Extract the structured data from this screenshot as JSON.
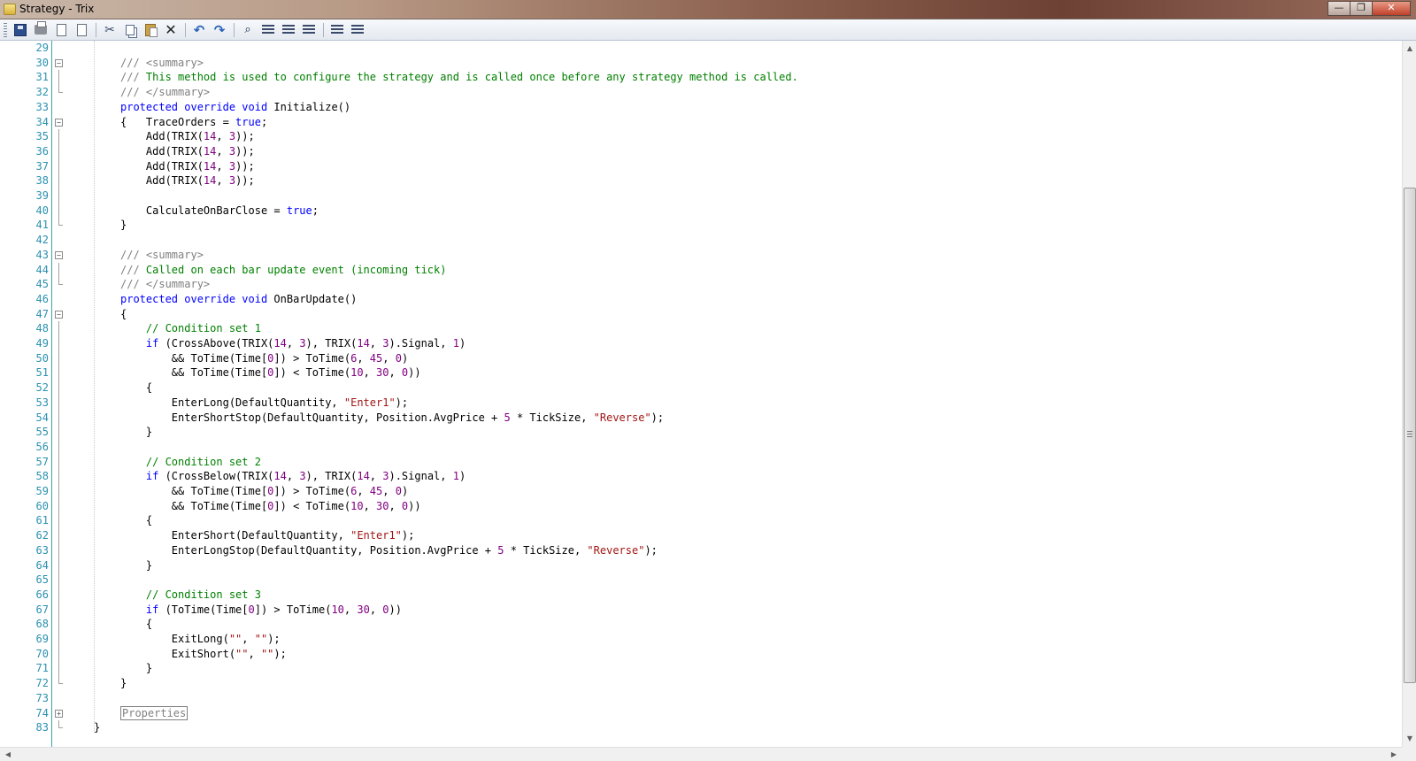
{
  "window": {
    "title": "Strategy - Trix",
    "min_label": "—",
    "max_label": "❐",
    "close_label": "✕"
  },
  "icons": {
    "save": "save-icon",
    "print": "print-icon",
    "preview": "print-preview-icon",
    "export": "export-icon",
    "cut": "cut-icon",
    "copy": "copy-icon",
    "paste": "paste-icon",
    "delete": "delete-icon",
    "undo": "undo-icon",
    "redo": "redo-icon",
    "find": "find-icon",
    "replace": "replace-icon",
    "indent": "indent-icon",
    "outdent": "outdent-icon",
    "comment": "comment-icon",
    "uncomment": "uncomment-icon"
  },
  "editor": {
    "lines": [
      {
        "num": "29",
        "fold": "",
        "tokens": []
      },
      {
        "num": "30",
        "fold": "minus",
        "tokens": [
          [
            "xd",
            "/// "
          ],
          [
            "xd",
            "<summary>"
          ]
        ]
      },
      {
        "num": "31",
        "fold": "bar",
        "tokens": [
          [
            "xd",
            "/// "
          ],
          [
            "cm",
            "This method is used to configure the strategy and is called once before any strategy method is called."
          ]
        ]
      },
      {
        "num": "32",
        "fold": "end",
        "tokens": [
          [
            "xd",
            "/// "
          ],
          [
            "xd",
            "</summary>"
          ]
        ]
      },
      {
        "num": "33",
        "fold": "",
        "tokens": [
          [
            "kw",
            "protected"
          ],
          [
            "",
            " "
          ],
          [
            "kw",
            "override"
          ],
          [
            "",
            " "
          ],
          [
            "kw",
            "void"
          ],
          [
            "",
            " Initialize()"
          ]
        ]
      },
      {
        "num": "34",
        "fold": "minus",
        "tokens": [
          [
            "",
            "{   TraceOrders = "
          ],
          [
            "kw",
            "true"
          ],
          [
            "",
            ";"
          ]
        ]
      },
      {
        "num": "35",
        "fold": "bar",
        "tokens": [
          [
            "",
            "    Add(TRIX("
          ],
          [
            "num",
            "14"
          ],
          [
            "",
            ", "
          ],
          [
            "num",
            "3"
          ],
          [
            "",
            "));"
          ]
        ]
      },
      {
        "num": "36",
        "fold": "bar",
        "tokens": [
          [
            "",
            "    Add(TRIX("
          ],
          [
            "num",
            "14"
          ],
          [
            "",
            ", "
          ],
          [
            "num",
            "3"
          ],
          [
            "",
            "));"
          ]
        ]
      },
      {
        "num": "37",
        "fold": "bar",
        "tokens": [
          [
            "",
            "    Add(TRIX("
          ],
          [
            "num",
            "14"
          ],
          [
            "",
            ", "
          ],
          [
            "num",
            "3"
          ],
          [
            "",
            "));"
          ]
        ]
      },
      {
        "num": "38",
        "fold": "bar",
        "tokens": [
          [
            "",
            "    Add(TRIX("
          ],
          [
            "num",
            "14"
          ],
          [
            "",
            ", "
          ],
          [
            "num",
            "3"
          ],
          [
            "",
            "));"
          ]
        ]
      },
      {
        "num": "39",
        "fold": "bar",
        "tokens": []
      },
      {
        "num": "40",
        "fold": "bar",
        "tokens": [
          [
            "",
            "    CalculateOnBarClose = "
          ],
          [
            "kw",
            "true"
          ],
          [
            "",
            ";"
          ]
        ]
      },
      {
        "num": "41",
        "fold": "end",
        "tokens": [
          [
            "",
            "}"
          ]
        ]
      },
      {
        "num": "42",
        "fold": "",
        "tokens": []
      },
      {
        "num": "43",
        "fold": "minus",
        "tokens": [
          [
            "xd",
            "/// "
          ],
          [
            "xd",
            "<summary>"
          ]
        ]
      },
      {
        "num": "44",
        "fold": "bar",
        "tokens": [
          [
            "xd",
            "/// "
          ],
          [
            "cm",
            "Called on each bar update event (incoming tick)"
          ]
        ]
      },
      {
        "num": "45",
        "fold": "end",
        "tokens": [
          [
            "xd",
            "/// "
          ],
          [
            "xd",
            "</summary>"
          ]
        ]
      },
      {
        "num": "46",
        "fold": "",
        "tokens": [
          [
            "kw",
            "protected"
          ],
          [
            "",
            " "
          ],
          [
            "kw",
            "override"
          ],
          [
            "",
            " "
          ],
          [
            "kw",
            "void"
          ],
          [
            "",
            " OnBarUpdate()"
          ]
        ]
      },
      {
        "num": "47",
        "fold": "minus",
        "tokens": [
          [
            "",
            "{"
          ]
        ]
      },
      {
        "num": "48",
        "fold": "bar",
        "tokens": [
          [
            "",
            "    "
          ],
          [
            "cm",
            "// Condition set 1"
          ]
        ]
      },
      {
        "num": "49",
        "fold": "bar",
        "tokens": [
          [
            "",
            "    "
          ],
          [
            "kw",
            "if"
          ],
          [
            "",
            " (CrossAbove(TRIX("
          ],
          [
            "num",
            "14"
          ],
          [
            "",
            ", "
          ],
          [
            "num",
            "3"
          ],
          [
            "",
            "), TRIX("
          ],
          [
            "num",
            "14"
          ],
          [
            "",
            ", "
          ],
          [
            "num",
            "3"
          ],
          [
            "",
            ").Signal, "
          ],
          [
            "num",
            "1"
          ],
          [
            "",
            ")"
          ]
        ]
      },
      {
        "num": "50",
        "fold": "bar",
        "tokens": [
          [
            "",
            "        && ToTime(Time["
          ],
          [
            "num",
            "0"
          ],
          [
            "",
            "]) > ToTime("
          ],
          [
            "num",
            "6"
          ],
          [
            "",
            ", "
          ],
          [
            "num",
            "45"
          ],
          [
            "",
            ", "
          ],
          [
            "num",
            "0"
          ],
          [
            "",
            ")"
          ]
        ]
      },
      {
        "num": "51",
        "fold": "bar",
        "tokens": [
          [
            "",
            "        && ToTime(Time["
          ],
          [
            "num",
            "0"
          ],
          [
            "",
            "]) < ToTime("
          ],
          [
            "num",
            "10"
          ],
          [
            "",
            ", "
          ],
          [
            "num",
            "30"
          ],
          [
            "",
            ", "
          ],
          [
            "num",
            "0"
          ],
          [
            "",
            "))"
          ]
        ]
      },
      {
        "num": "52",
        "fold": "bar",
        "tokens": [
          [
            "",
            "    {"
          ]
        ]
      },
      {
        "num": "53",
        "fold": "bar",
        "tokens": [
          [
            "",
            "        EnterLong(DefaultQuantity, "
          ],
          [
            "str",
            "\"Enter1\""
          ],
          [
            "",
            ");"
          ]
        ]
      },
      {
        "num": "54",
        "fold": "bar",
        "tokens": [
          [
            "",
            "        EnterShortStop(DefaultQuantity, Position.AvgPrice + "
          ],
          [
            "num",
            "5"
          ],
          [
            "",
            " * TickSize, "
          ],
          [
            "str",
            "\"Reverse\""
          ],
          [
            "",
            ");"
          ]
        ]
      },
      {
        "num": "55",
        "fold": "bar",
        "tokens": [
          [
            "",
            "    }"
          ]
        ]
      },
      {
        "num": "56",
        "fold": "bar",
        "tokens": []
      },
      {
        "num": "57",
        "fold": "bar",
        "tokens": [
          [
            "",
            "    "
          ],
          [
            "cm",
            "// Condition set 2"
          ]
        ]
      },
      {
        "num": "58",
        "fold": "bar",
        "tokens": [
          [
            "",
            "    "
          ],
          [
            "kw",
            "if"
          ],
          [
            "",
            " (CrossBelow(TRIX("
          ],
          [
            "num",
            "14"
          ],
          [
            "",
            ", "
          ],
          [
            "num",
            "3"
          ],
          [
            "",
            "), TRIX("
          ],
          [
            "num",
            "14"
          ],
          [
            "",
            ", "
          ],
          [
            "num",
            "3"
          ],
          [
            "",
            ").Signal, "
          ],
          [
            "num",
            "1"
          ],
          [
            "",
            ")"
          ]
        ]
      },
      {
        "num": "59",
        "fold": "bar",
        "tokens": [
          [
            "",
            "        && ToTime(Time["
          ],
          [
            "num",
            "0"
          ],
          [
            "",
            "]) > ToTime("
          ],
          [
            "num",
            "6"
          ],
          [
            "",
            ", "
          ],
          [
            "num",
            "45"
          ],
          [
            "",
            ", "
          ],
          [
            "num",
            "0"
          ],
          [
            "",
            ")"
          ]
        ]
      },
      {
        "num": "60",
        "fold": "bar",
        "tokens": [
          [
            "",
            "        && ToTime(Time["
          ],
          [
            "num",
            "0"
          ],
          [
            "",
            "]) < ToTime("
          ],
          [
            "num",
            "10"
          ],
          [
            "",
            ", "
          ],
          [
            "num",
            "30"
          ],
          [
            "",
            ", "
          ],
          [
            "num",
            "0"
          ],
          [
            "",
            "))"
          ]
        ]
      },
      {
        "num": "61",
        "fold": "bar",
        "tokens": [
          [
            "",
            "    {"
          ]
        ]
      },
      {
        "num": "62",
        "fold": "bar",
        "tokens": [
          [
            "",
            "        EnterShort(DefaultQuantity, "
          ],
          [
            "str",
            "\"Enter1\""
          ],
          [
            "",
            ");"
          ]
        ]
      },
      {
        "num": "63",
        "fold": "bar",
        "tokens": [
          [
            "",
            "        EnterLongStop(DefaultQuantity, Position.AvgPrice + "
          ],
          [
            "num",
            "5"
          ],
          [
            "",
            " * TickSize, "
          ],
          [
            "str",
            "\"Reverse\""
          ],
          [
            "",
            ");"
          ]
        ]
      },
      {
        "num": "64",
        "fold": "bar",
        "tokens": [
          [
            "",
            "    }"
          ]
        ]
      },
      {
        "num": "65",
        "fold": "bar",
        "tokens": []
      },
      {
        "num": "66",
        "fold": "bar",
        "tokens": [
          [
            "",
            "    "
          ],
          [
            "cm",
            "// Condition set 3"
          ]
        ]
      },
      {
        "num": "67",
        "fold": "bar",
        "tokens": [
          [
            "",
            "    "
          ],
          [
            "kw",
            "if"
          ],
          [
            "",
            " (ToTime(Time["
          ],
          [
            "num",
            "0"
          ],
          [
            "",
            "]) > ToTime("
          ],
          [
            "num",
            "10"
          ],
          [
            "",
            ", "
          ],
          [
            "num",
            "30"
          ],
          [
            "",
            ", "
          ],
          [
            "num",
            "0"
          ],
          [
            "",
            "))"
          ]
        ]
      },
      {
        "num": "68",
        "fold": "bar",
        "tokens": [
          [
            "",
            "    {"
          ]
        ]
      },
      {
        "num": "69",
        "fold": "bar",
        "tokens": [
          [
            "",
            "        ExitLong("
          ],
          [
            "str",
            "\"\""
          ],
          [
            "",
            ", "
          ],
          [
            "str",
            "\"\""
          ],
          [
            "",
            ");"
          ]
        ]
      },
      {
        "num": "70",
        "fold": "bar",
        "tokens": [
          [
            "",
            "        ExitShort("
          ],
          [
            "str",
            "\"\""
          ],
          [
            "",
            ", "
          ],
          [
            "str",
            "\"\""
          ],
          [
            "",
            ");"
          ]
        ]
      },
      {
        "num": "71",
        "fold": "bar",
        "tokens": [
          [
            "",
            "    }"
          ]
        ]
      },
      {
        "num": "72",
        "fold": "end",
        "tokens": [
          [
            "",
            "}"
          ]
        ]
      },
      {
        "num": "73",
        "fold": "",
        "tokens": []
      },
      {
        "num": "74",
        "fold": "plus",
        "tokens": [
          [
            "region",
            "Properties"
          ]
        ]
      },
      {
        "num": "83",
        "fold": "end",
        "tokens": [
          [
            "outer",
            "}"
          ]
        ]
      }
    ]
  }
}
